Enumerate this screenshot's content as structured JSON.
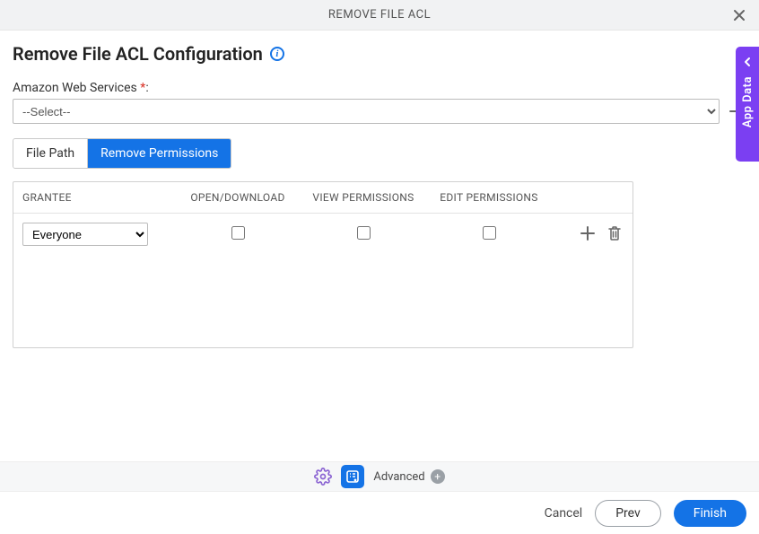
{
  "header": {
    "title": "REMOVE FILE ACL"
  },
  "page_title": "Remove File ACL Configuration",
  "aws_field": {
    "label": "Amazon Web Services",
    "required_marker": "*",
    "value": "--Select--",
    "options": [
      "--Select--"
    ]
  },
  "tabs": {
    "file_path": "File Path",
    "remove_permissions": "Remove Permissions",
    "active": "remove_permissions"
  },
  "permissions_table": {
    "headers": {
      "grantee": "GRANTEE",
      "open_download": "OPEN/DOWNLOAD",
      "view_permissions": "VIEW PERMISSIONS",
      "edit_permissions": "EDIT PERMISSIONS"
    },
    "rows": [
      {
        "grantee": "Everyone",
        "open_download": false,
        "view_permissions": false,
        "edit_permissions": false
      }
    ]
  },
  "advanced": {
    "label": "Advanced"
  },
  "footer": {
    "cancel": "Cancel",
    "prev": "Prev",
    "finish": "Finish"
  },
  "side_tab": {
    "label": "App Data"
  }
}
